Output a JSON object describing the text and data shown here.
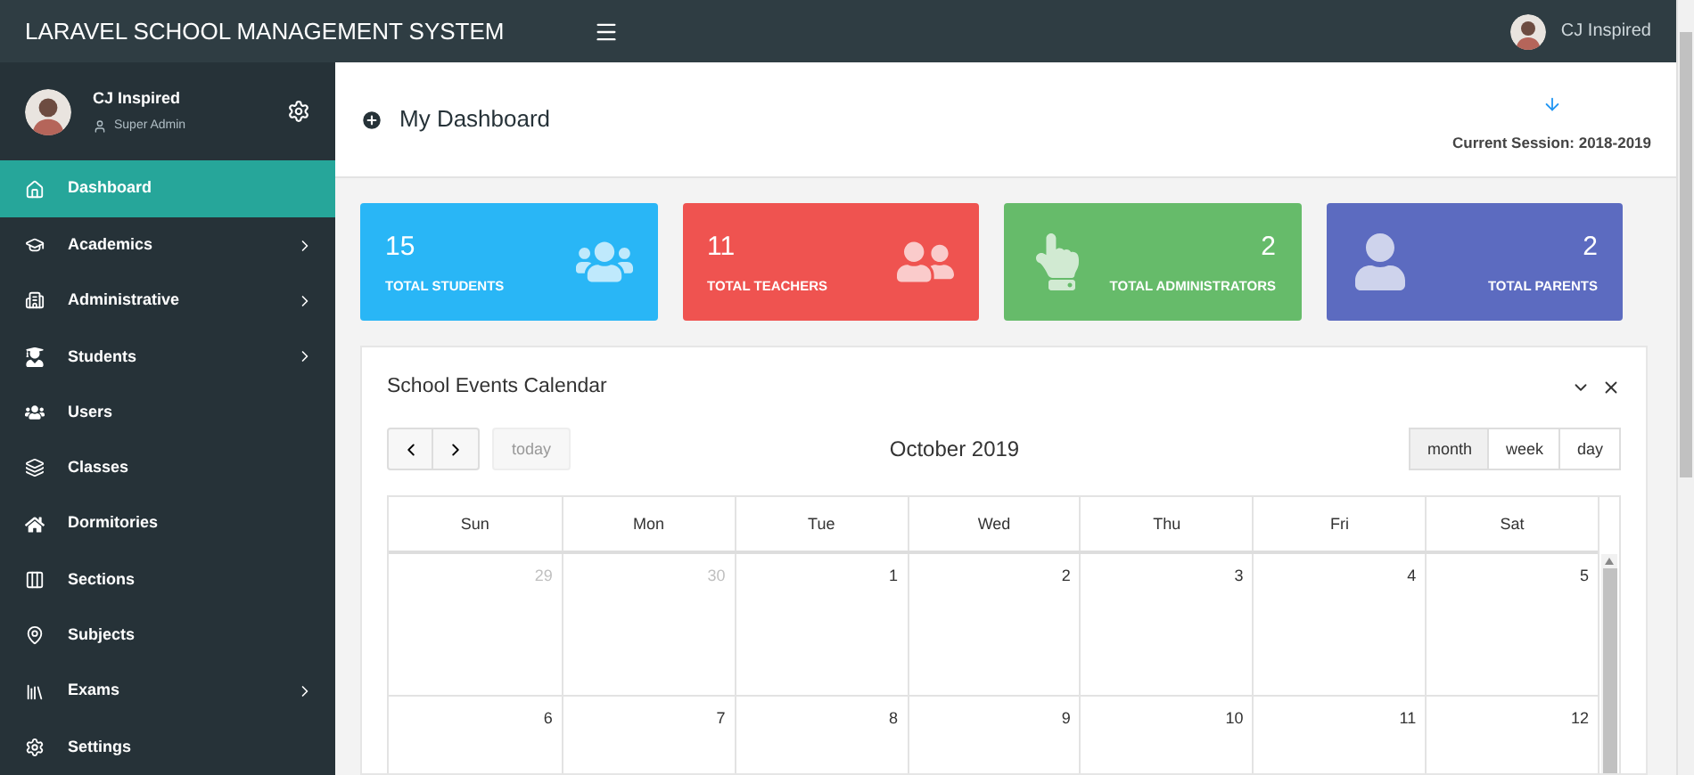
{
  "brand": "LARAVEL SCHOOL MANAGEMENT SYSTEM",
  "top_user": {
    "name": "CJ Inspired"
  },
  "sidebar": {
    "user": {
      "name": "CJ Inspired",
      "role": "Super Admin"
    },
    "items": [
      {
        "label": "Dashboard",
        "selected": true,
        "has_submenu": false
      },
      {
        "label": "Academics",
        "selected": false,
        "has_submenu": true
      },
      {
        "label": "Administrative",
        "selected": false,
        "has_submenu": true
      },
      {
        "label": "Students",
        "selected": false,
        "has_submenu": true
      },
      {
        "label": "Users",
        "selected": false,
        "has_submenu": false
      },
      {
        "label": "Classes",
        "selected": false,
        "has_submenu": false
      },
      {
        "label": "Dormitories",
        "selected": false,
        "has_submenu": false
      },
      {
        "label": "Sections",
        "selected": false,
        "has_submenu": false
      },
      {
        "label": "Subjects",
        "selected": false,
        "has_submenu": false
      },
      {
        "label": "Exams",
        "selected": false,
        "has_submenu": true
      },
      {
        "label": "Settings",
        "selected": false,
        "has_submenu": false
      }
    ]
  },
  "page_header": {
    "title": "My Dashboard",
    "session": "Current Session: 2018-2019"
  },
  "stats": [
    {
      "value": "15",
      "label": "TOTAL STUDENTS",
      "color": "#29b6f6",
      "kind": "start"
    },
    {
      "value": "11",
      "label": "TOTAL TEACHERS",
      "color": "#ef5350",
      "kind": "start"
    },
    {
      "value": "2",
      "label": "TOTAL ADMINISTRATORS",
      "color": "#66bb6a",
      "kind": "end"
    },
    {
      "value": "2",
      "label": "TOTAL PARENTS",
      "color": "#5c6bc0",
      "kind": "end"
    }
  ],
  "calendar": {
    "title": "School Events Calendar",
    "today_button": {
      "label": "today",
      "disabled": true
    },
    "month": "October 2019",
    "views": [
      {
        "label": "month",
        "selected": true
      },
      {
        "label": "week",
        "selected": false
      },
      {
        "label": "day",
        "selected": false
      }
    ],
    "weekdays": [
      "Sun",
      "Mon",
      "Tue",
      "Wed",
      "Thu",
      "Fri",
      "Sat"
    ],
    "weeks": [
      [
        {
          "day": "29",
          "other_month": true
        },
        {
          "day": "30",
          "other_month": true
        },
        {
          "day": "1",
          "other_month": false
        },
        {
          "day": "2",
          "other_month": false
        },
        {
          "day": "3",
          "other_month": false
        },
        {
          "day": "4",
          "other_month": false
        },
        {
          "day": "5",
          "other_month": false
        }
      ],
      [
        {
          "day": "6",
          "other_month": false
        },
        {
          "day": "7",
          "other_month": false
        },
        {
          "day": "8",
          "other_month": false
        },
        {
          "day": "9",
          "other_month": false
        },
        {
          "day": "10",
          "other_month": false
        },
        {
          "day": "11",
          "other_month": false
        },
        {
          "day": "12",
          "other_month": false
        }
      ]
    ]
  }
}
